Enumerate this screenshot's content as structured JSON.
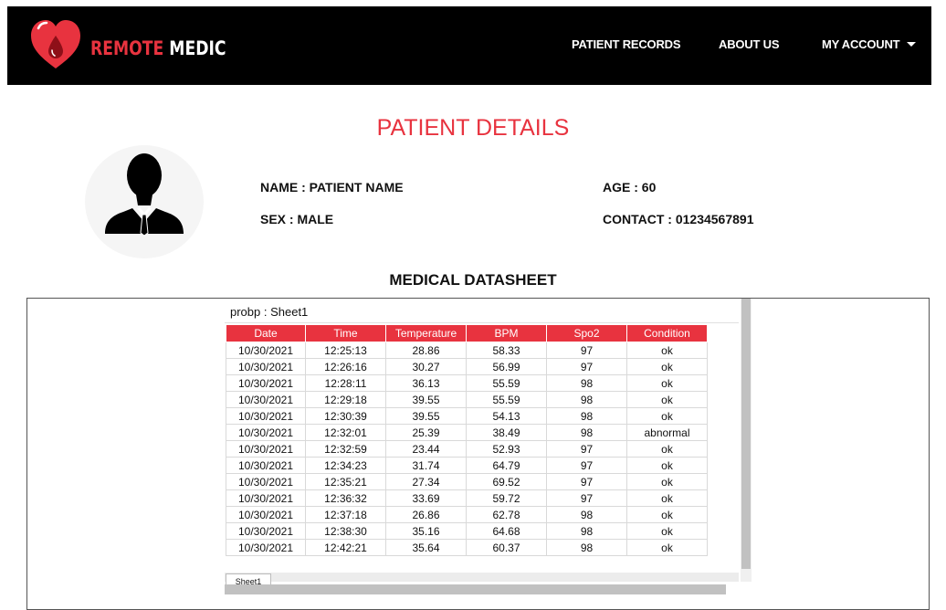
{
  "brand": {
    "part1": "REMOTE",
    "part2": "MEDIC"
  },
  "nav": {
    "patient_records": "PATIENT RECORDS",
    "about_us": "ABOUT US",
    "my_account": "MY ACCOUNT"
  },
  "page": {
    "title": "PATIENT DETAILS"
  },
  "patient": {
    "name": "NAME : PATIENT NAME",
    "sex": "SEX : MALE",
    "age": "AGE : 60",
    "contact": "CONTACT : 01234567891"
  },
  "datasheet": {
    "section_title": "MEDICAL DATASHEET",
    "caption": "probp : Sheet1",
    "tab_label": "Sheet1",
    "columns": [
      "Date",
      "Time",
      "Temperature",
      "BPM",
      "Spo2",
      "Condition"
    ],
    "rows": [
      [
        "10/30/2021",
        "12:25:13",
        "28.86",
        "58.33",
        "97",
        "ok"
      ],
      [
        "10/30/2021",
        "12:26:16",
        "30.27",
        "56.99",
        "97",
        "ok"
      ],
      [
        "10/30/2021",
        "12:28:11",
        "36.13",
        "55.59",
        "98",
        "ok"
      ],
      [
        "10/30/2021",
        "12:29:18",
        "39.55",
        "55.59",
        "98",
        "ok"
      ],
      [
        "10/30/2021",
        "12:30:39",
        "39.55",
        "54.13",
        "98",
        "ok"
      ],
      [
        "10/30/2021",
        "12:32:01",
        "25.39",
        "38.49",
        "98",
        "abnormal"
      ],
      [
        "10/30/2021",
        "12:32:59",
        "23.44",
        "52.93",
        "97",
        "ok"
      ],
      [
        "10/30/2021",
        "12:34:23",
        "31.74",
        "64.79",
        "97",
        "ok"
      ],
      [
        "10/30/2021",
        "12:35:21",
        "27.34",
        "69.52",
        "97",
        "ok"
      ],
      [
        "10/30/2021",
        "12:36:32",
        "33.69",
        "59.72",
        "97",
        "ok"
      ],
      [
        "10/30/2021",
        "12:37:18",
        "26.86",
        "62.78",
        "98",
        "ok"
      ],
      [
        "10/30/2021",
        "12:38:30",
        "35.16",
        "64.68",
        "98",
        "ok"
      ],
      [
        "10/30/2021",
        "12:42:21",
        "35.64",
        "60.37",
        "98",
        "ok"
      ]
    ]
  },
  "colors": {
    "accent": "#e8333f",
    "header_bg": "#000000",
    "text": "#111111"
  },
  "icons": {
    "logo": "heart-drop-icon",
    "dropdown": "caret-down-icon",
    "avatar": "user-silhouette-icon"
  }
}
